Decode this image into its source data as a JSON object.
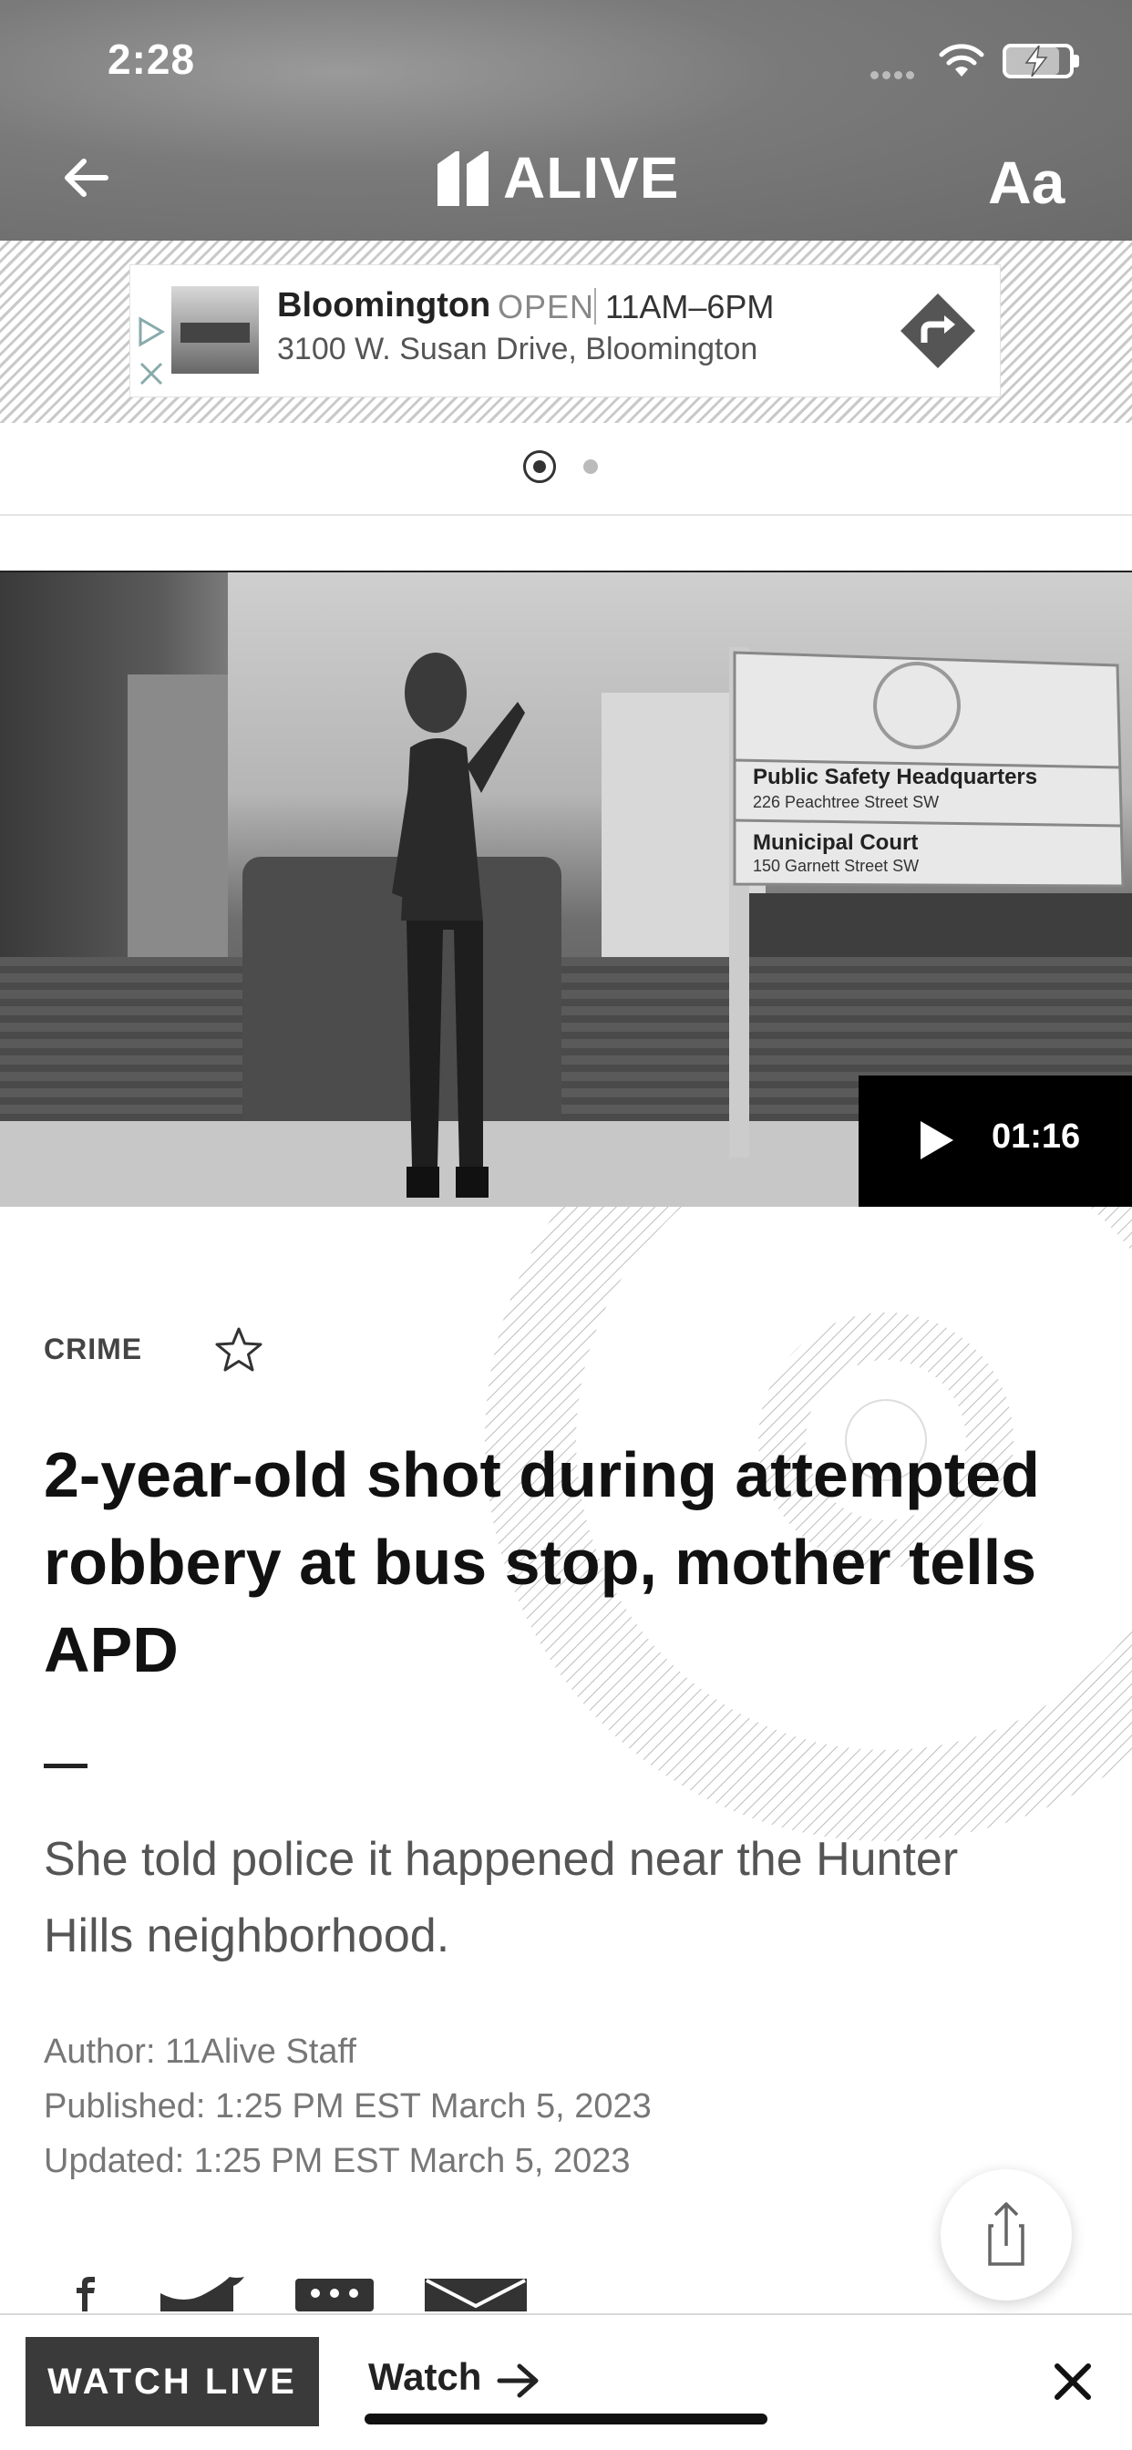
{
  "status_bar": {
    "time": "2:28"
  },
  "header": {
    "brand_text": "ALIVE",
    "font_size_control": "Aa"
  },
  "ad": {
    "title": "Bloomington",
    "status": "OPEN",
    "hours": "11AM–6PM",
    "address": "3100 W. Susan Drive, Bloomington"
  },
  "video": {
    "duration": "01:16",
    "sign_line1": "Public Safety Headquarters",
    "sign_line1_sub": "226 Peachtree Street SW",
    "sign_line2": "Municipal Court",
    "sign_line2_sub": "150 Garnett Street SW"
  },
  "article": {
    "category": "CRIME",
    "headline": "2-year-old shot during attempted robbery at bus stop, mother tells APD",
    "subhead": "She told police it happened near the Hunter Hills neighborhood.",
    "author": "Author: 11Alive Staff",
    "published": "Published: 1:25 PM EST March 5, 2023",
    "updated": "Updated: 1:25 PM EST March 5, 2023"
  },
  "bottom_bar": {
    "watch_live": "WATCH LIVE",
    "watch_link": "Watch"
  },
  "icons": [
    "back-arrow-icon",
    "text-size-icon",
    "ad-choices-icon",
    "close-icon",
    "directions-icon",
    "play-icon",
    "star-icon",
    "share-icon",
    "facebook-icon",
    "twitter-icon",
    "more-icon",
    "mail-icon",
    "arrow-right-icon",
    "wifi-icon",
    "battery-icon"
  ],
  "colors": {
    "header_bg": "#7a7a7a",
    "video_badge": "#000000",
    "watch_live_bg": "#3a3a3a"
  }
}
